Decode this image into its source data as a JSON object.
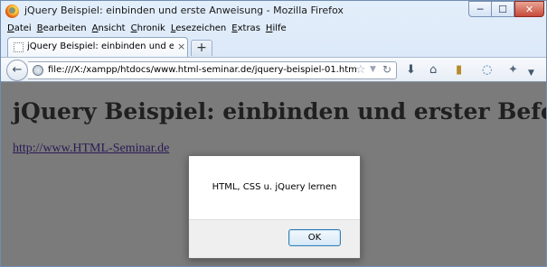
{
  "window": {
    "title": "jQuery Beispiel: einbinden und erste Anweisung - Mozilla Firefox",
    "controls": {
      "minimize": "─",
      "maximize": "☐",
      "close": "✕"
    }
  },
  "menu": {
    "items": [
      {
        "label": "Datei"
      },
      {
        "label": "Bearbeiten"
      },
      {
        "label": "Ansicht"
      },
      {
        "label": "Chronik"
      },
      {
        "label": "Lesezeichen"
      },
      {
        "label": "Extras"
      },
      {
        "label": "Hilfe"
      }
    ]
  },
  "tab": {
    "title": "jQuery Beispiel: einbinden und erste An...",
    "close": "×",
    "new_tab": "+"
  },
  "nav": {
    "url": "file:///X:/xampp/htdocs/www.html-seminar.de/jquery-beispiel-01.htm",
    "icons": {
      "back": "back-arrow-icon",
      "site": "globe-icon",
      "bookmark_star": "star-icon",
      "reload": "reload-icon",
      "downloads": "download-icon",
      "home": "home-icon",
      "bookmarks": "bookmark-icon",
      "chat": "chat-icon",
      "tools": "tools-icon"
    }
  },
  "page": {
    "heading": "jQuery Beispiel: einbinden und erster Befehl",
    "link": "http://www.HTML-Seminar.de"
  },
  "dialog": {
    "message": "HTML, CSS u. jQuery lernen",
    "ok_label": "OK"
  },
  "colors": {
    "overlay": "#7b7b7b",
    "titlebar": "#cfe0f3",
    "close_button": "#c7493a",
    "ok_border": "#3c7fb1"
  }
}
